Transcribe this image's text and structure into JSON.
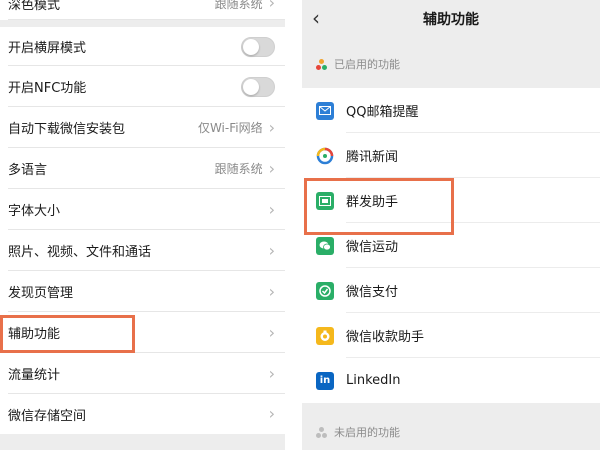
{
  "left": {
    "items": [
      {
        "label": "深色模式",
        "value": "跟随系统"
      },
      {
        "label": "开启横屏模式"
      },
      {
        "label": "开启NFC功能"
      },
      {
        "label": "自动下载微信安装包",
        "value": "仅Wi-Fi网络"
      },
      {
        "label": "多语言",
        "value": "跟随系统"
      },
      {
        "label": "字体大小"
      },
      {
        "label": "照片、视频、文件和通话"
      },
      {
        "label": "发现页管理"
      },
      {
        "label": "辅助功能"
      },
      {
        "label": "流量统计"
      },
      {
        "label": "微信存储空间"
      }
    ],
    "chevron": "›"
  },
  "right": {
    "header": {
      "back": "‹",
      "title": "辅助功能"
    },
    "enabled_section": "已启用的功能",
    "disabled_section": "未启用的功能",
    "items": [
      {
        "label": "QQ邮箱提醒",
        "icon": "mail-icon",
        "color": "#2d7fd6"
      },
      {
        "label": "腾讯新闻",
        "icon": "news-icon",
        "color": "#e6453a"
      },
      {
        "label": "群发助手",
        "icon": "broadcast-icon",
        "color": "#2aae67"
      },
      {
        "label": "微信运动",
        "icon": "chat-icon",
        "color": "#2aae67"
      },
      {
        "label": "微信支付",
        "icon": "pay-icon",
        "color": "#2aae67"
      },
      {
        "label": "微信收款助手",
        "icon": "money-icon",
        "color": "#f5b81c"
      },
      {
        "label": "LinkedIn",
        "icon": "linkedin-icon",
        "color": "#0a66c2",
        "glyph": "in"
      }
    ]
  },
  "colors": {
    "highlight": "#e8704a",
    "background": "#ededed"
  }
}
